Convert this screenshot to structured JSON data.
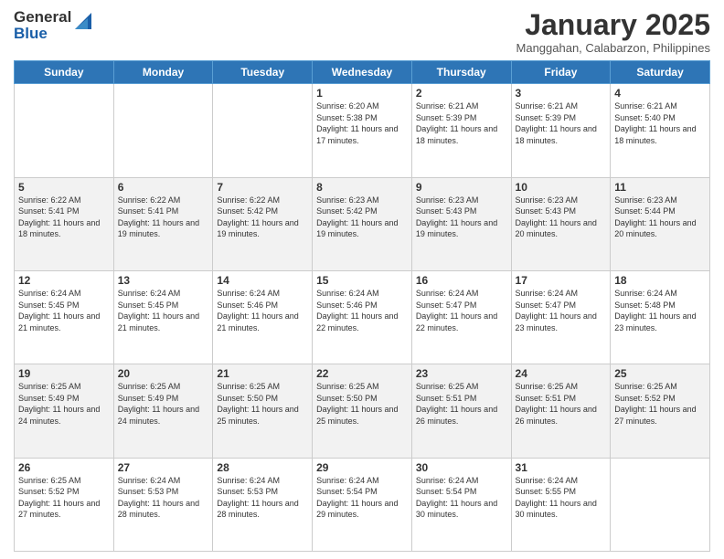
{
  "header": {
    "logo_line1": "General",
    "logo_line2": "Blue",
    "month": "January 2025",
    "location": "Manggahan, Calabarzon, Philippines"
  },
  "days_of_week": [
    "Sunday",
    "Monday",
    "Tuesday",
    "Wednesday",
    "Thursday",
    "Friday",
    "Saturday"
  ],
  "weeks": [
    [
      {
        "day": "",
        "sunrise": "",
        "sunset": "",
        "daylight": ""
      },
      {
        "day": "",
        "sunrise": "",
        "sunset": "",
        "daylight": ""
      },
      {
        "day": "",
        "sunrise": "",
        "sunset": "",
        "daylight": ""
      },
      {
        "day": "1",
        "sunrise": "6:20 AM",
        "sunset": "5:38 PM",
        "daylight": "11 hours and 17 minutes."
      },
      {
        "day": "2",
        "sunrise": "6:21 AM",
        "sunset": "5:39 PM",
        "daylight": "11 hours and 18 minutes."
      },
      {
        "day": "3",
        "sunrise": "6:21 AM",
        "sunset": "5:39 PM",
        "daylight": "11 hours and 18 minutes."
      },
      {
        "day": "4",
        "sunrise": "6:21 AM",
        "sunset": "5:40 PM",
        "daylight": "11 hours and 18 minutes."
      }
    ],
    [
      {
        "day": "5",
        "sunrise": "6:22 AM",
        "sunset": "5:41 PM",
        "daylight": "11 hours and 18 minutes."
      },
      {
        "day": "6",
        "sunrise": "6:22 AM",
        "sunset": "5:41 PM",
        "daylight": "11 hours and 19 minutes."
      },
      {
        "day": "7",
        "sunrise": "6:22 AM",
        "sunset": "5:42 PM",
        "daylight": "11 hours and 19 minutes."
      },
      {
        "day": "8",
        "sunrise": "6:23 AM",
        "sunset": "5:42 PM",
        "daylight": "11 hours and 19 minutes."
      },
      {
        "day": "9",
        "sunrise": "6:23 AM",
        "sunset": "5:43 PM",
        "daylight": "11 hours and 19 minutes."
      },
      {
        "day": "10",
        "sunrise": "6:23 AM",
        "sunset": "5:43 PM",
        "daylight": "11 hours and 20 minutes."
      },
      {
        "day": "11",
        "sunrise": "6:23 AM",
        "sunset": "5:44 PM",
        "daylight": "11 hours and 20 minutes."
      }
    ],
    [
      {
        "day": "12",
        "sunrise": "6:24 AM",
        "sunset": "5:45 PM",
        "daylight": "11 hours and 21 minutes."
      },
      {
        "day": "13",
        "sunrise": "6:24 AM",
        "sunset": "5:45 PM",
        "daylight": "11 hours and 21 minutes."
      },
      {
        "day": "14",
        "sunrise": "6:24 AM",
        "sunset": "5:46 PM",
        "daylight": "11 hours and 21 minutes."
      },
      {
        "day": "15",
        "sunrise": "6:24 AM",
        "sunset": "5:46 PM",
        "daylight": "11 hours and 22 minutes."
      },
      {
        "day": "16",
        "sunrise": "6:24 AM",
        "sunset": "5:47 PM",
        "daylight": "11 hours and 22 minutes."
      },
      {
        "day": "17",
        "sunrise": "6:24 AM",
        "sunset": "5:47 PM",
        "daylight": "11 hours and 23 minutes."
      },
      {
        "day": "18",
        "sunrise": "6:24 AM",
        "sunset": "5:48 PM",
        "daylight": "11 hours and 23 minutes."
      }
    ],
    [
      {
        "day": "19",
        "sunrise": "6:25 AM",
        "sunset": "5:49 PM",
        "daylight": "11 hours and 24 minutes."
      },
      {
        "day": "20",
        "sunrise": "6:25 AM",
        "sunset": "5:49 PM",
        "daylight": "11 hours and 24 minutes."
      },
      {
        "day": "21",
        "sunrise": "6:25 AM",
        "sunset": "5:50 PM",
        "daylight": "11 hours and 25 minutes."
      },
      {
        "day": "22",
        "sunrise": "6:25 AM",
        "sunset": "5:50 PM",
        "daylight": "11 hours and 25 minutes."
      },
      {
        "day": "23",
        "sunrise": "6:25 AM",
        "sunset": "5:51 PM",
        "daylight": "11 hours and 26 minutes."
      },
      {
        "day": "24",
        "sunrise": "6:25 AM",
        "sunset": "5:51 PM",
        "daylight": "11 hours and 26 minutes."
      },
      {
        "day": "25",
        "sunrise": "6:25 AM",
        "sunset": "5:52 PM",
        "daylight": "11 hours and 27 minutes."
      }
    ],
    [
      {
        "day": "26",
        "sunrise": "6:25 AM",
        "sunset": "5:52 PM",
        "daylight": "11 hours and 27 minutes."
      },
      {
        "day": "27",
        "sunrise": "6:24 AM",
        "sunset": "5:53 PM",
        "daylight": "11 hours and 28 minutes."
      },
      {
        "day": "28",
        "sunrise": "6:24 AM",
        "sunset": "5:53 PM",
        "daylight": "11 hours and 28 minutes."
      },
      {
        "day": "29",
        "sunrise": "6:24 AM",
        "sunset": "5:54 PM",
        "daylight": "11 hours and 29 minutes."
      },
      {
        "day": "30",
        "sunrise": "6:24 AM",
        "sunset": "5:54 PM",
        "daylight": "11 hours and 30 minutes."
      },
      {
        "day": "31",
        "sunrise": "6:24 AM",
        "sunset": "5:55 PM",
        "daylight": "11 hours and 30 minutes."
      },
      {
        "day": "",
        "sunrise": "",
        "sunset": "",
        "daylight": ""
      }
    ]
  ]
}
